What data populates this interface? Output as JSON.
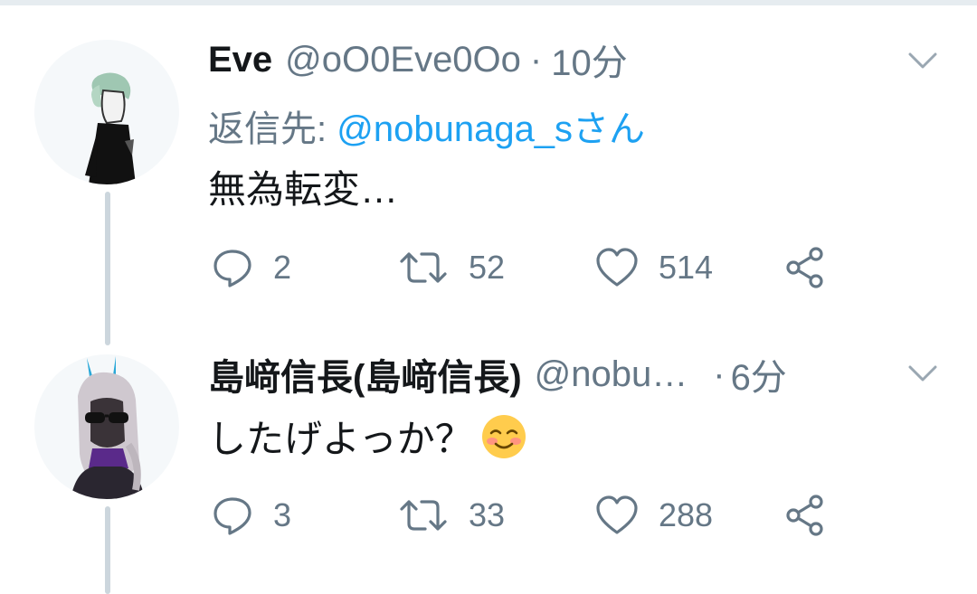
{
  "tweets": [
    {
      "display_name": "Eve",
      "handle": "@oO0Eve0Oo",
      "separator": "·",
      "time": "10分",
      "reply_prefix": "返信先: ",
      "reply_mention": "@nobunaga_sさん",
      "text": "無為転変…",
      "replies": "2",
      "retweets": "52",
      "likes": "514"
    },
    {
      "display_name": "島﨑信長(島﨑信長)",
      "handle": "@nobu…",
      "separator": "·",
      "time": "6分",
      "text": "したげよっか？",
      "emoji": "smiling-face-with-blush-emoji",
      "replies": "3",
      "retweets": "33",
      "likes": "288"
    }
  ],
  "icons": {
    "more": "chevron-down-icon",
    "reply": "speech-bubble-icon",
    "retweet": "retweet-arrows-icon",
    "like": "heart-outline-icon",
    "share": "share-nodes-icon"
  },
  "colors": {
    "text": "#14171a",
    "secondary": "#657786",
    "link": "#1da1f2",
    "thread_line": "#ccd6dd",
    "divider": "#e6ecf0"
  }
}
